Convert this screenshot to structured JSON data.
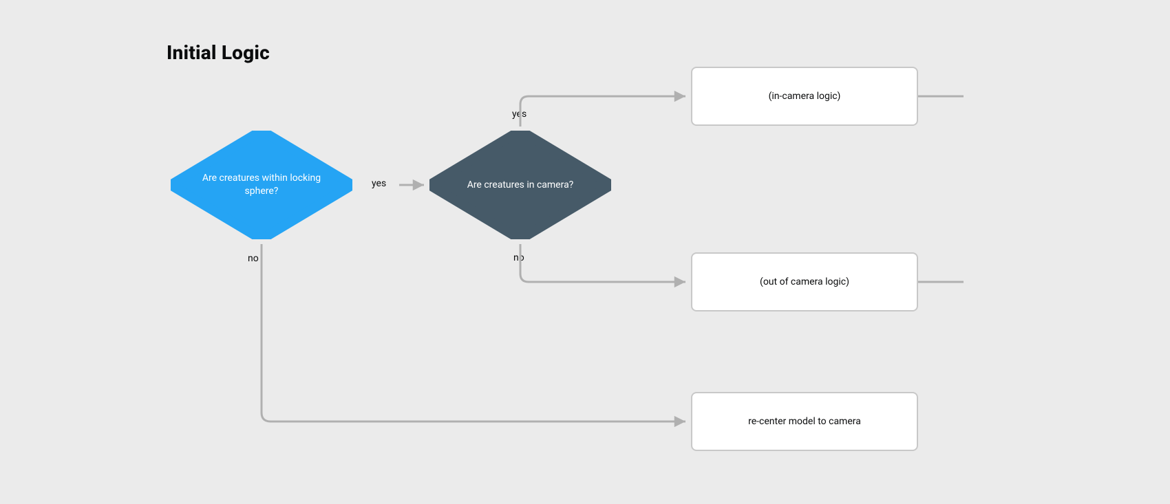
{
  "title": "Initial Logic",
  "nodes": {
    "d1": {
      "text": "Are creatures within locking sphere?"
    },
    "d2": {
      "text": "Are creatures in camera?"
    },
    "b1": {
      "text": "(in-camera logic)"
    },
    "b2": {
      "text": "(out of camera logic)"
    },
    "b3": {
      "text": "re-center model to camera"
    }
  },
  "edgeLabels": {
    "d1_yes": "yes",
    "d1_no": "no",
    "d2_yes": "yes",
    "d2_no": "no"
  },
  "colors": {
    "decisionPrimary": "#25a4f4",
    "decisionSecondary": "#465a68",
    "edge": "#b0b0b0",
    "boxBorder": "#c8c8c8",
    "bg": "#ebebeb"
  }
}
